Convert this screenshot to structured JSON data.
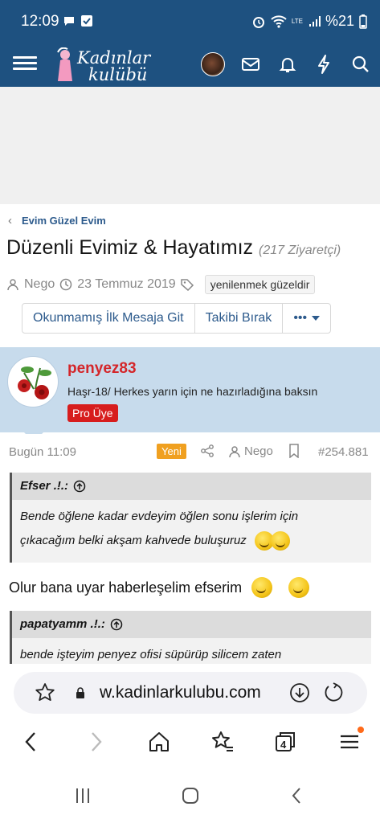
{
  "status_bar": {
    "time": "12:09",
    "battery": "%21",
    "network": "LTE"
  },
  "app_header": {
    "logo_line1": "Kadınlar",
    "logo_line2": "kulübü",
    "icons": [
      "menu-icon",
      "avatar",
      "mail-icon",
      "bell-icon",
      "bolt-icon",
      "search-icon"
    ]
  },
  "breadcrumb": {
    "label": "Evim Güzel Evim"
  },
  "thread": {
    "title": "Düzenli Evimiz & Hayatımız",
    "visits": "(217 Ziyaretçi)",
    "author": "Nego",
    "date": "23 Temmuz 2019",
    "tag": "yenilenmek güzeldir"
  },
  "actions": {
    "unread": "Okunmamış İlk Mesaja Git",
    "unfollow": "Takibi Bırak",
    "more": "•••"
  },
  "post": {
    "username": "penyez83",
    "user_title": "Haşr-18/ Herkes yarın için ne hazırladığına baksın",
    "badge": "Pro Üye",
    "date": "Bugün 11:09",
    "new_label": "Yeni",
    "mention_user": "Nego",
    "post_number": "#254.881",
    "quote1": {
      "author": "Efser .!.:",
      "line1": "Bende öğlene kadar evdeyim öğlen sonu işlerim için",
      "line2": "çıkacağım belki akşam kahvede buluşuruz"
    },
    "reply": "Olur bana uyar haberleşelim efserim",
    "quote2": {
      "author": "papatyamm .!.:",
      "line1": "bende işteyim penyez ofisi süpürüp silicem zaten"
    }
  },
  "browser": {
    "url": "w.kadinlarkulubu.com",
    "tab_count": "4"
  },
  "colors": {
    "header_blue": "#1e5180",
    "link_blue": "#2c5a8c",
    "user_red": "#d4262a",
    "badge_red": "#d71d1d",
    "new_orange": "#f0a020",
    "user_bg": "#c7dbec"
  }
}
